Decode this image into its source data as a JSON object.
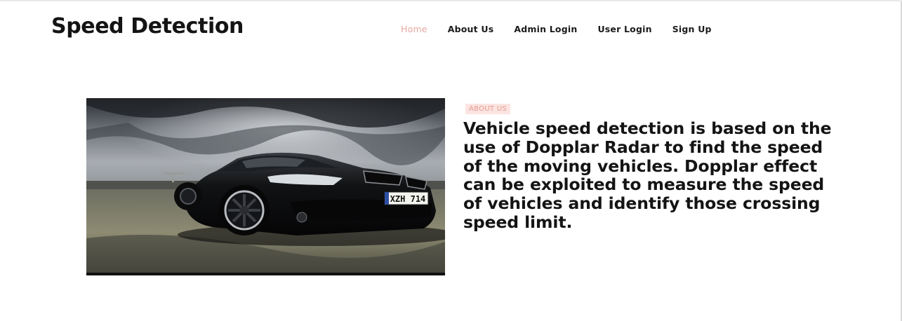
{
  "header": {
    "brand": "Speed Detection",
    "nav": [
      {
        "label": "Home",
        "active": true
      },
      {
        "label": "About Us",
        "active": false
      },
      {
        "label": "Admin Login",
        "active": false
      },
      {
        "label": "User Login",
        "active": false
      },
      {
        "label": "Sign Up",
        "active": false
      }
    ]
  },
  "about": {
    "badge": "ABOUT US",
    "text": "Vehicle speed detection is based on the use of Dopplar Radar to find the speed of the moving vehicles. Dopplar effect can be exploited to measure the speed of vehicles and identify those crossing speed limit."
  },
  "hero_image": {
    "plate": "XZH 714"
  },
  "colors": {
    "accent": "#e8a79e",
    "badge_bg": "#fbe4e1",
    "text": "#141414"
  }
}
